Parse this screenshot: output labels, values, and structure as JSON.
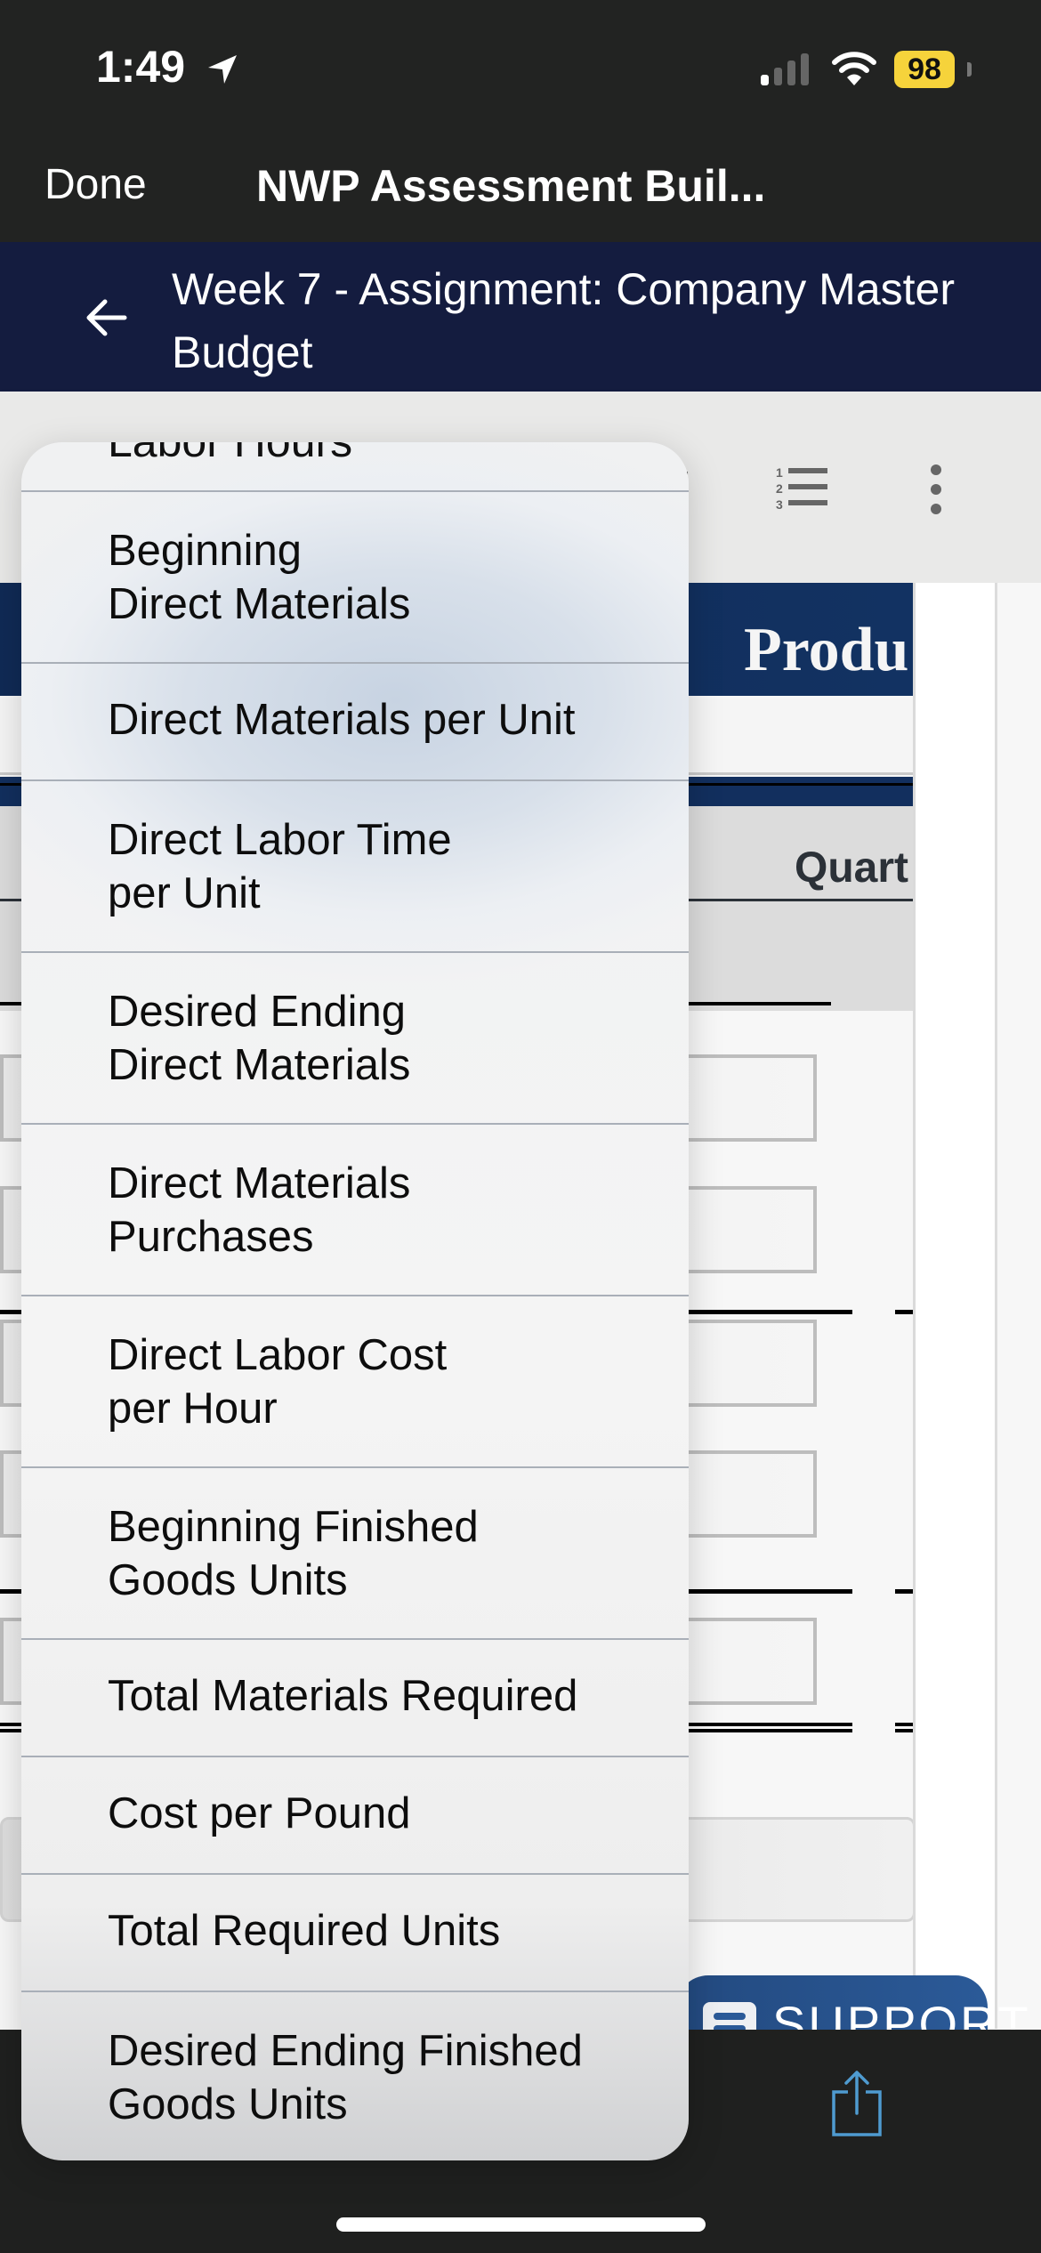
{
  "status_bar": {
    "time": "1:49",
    "battery": "98",
    "icons": [
      "location-arrow-icon",
      "cellular-signal-icon",
      "wifi-icon",
      "battery-icon"
    ]
  },
  "browser_nav": {
    "done_label": "Done",
    "title": "NWP Assessment Buil..."
  },
  "header": {
    "back_icon": "arrow-left-icon",
    "title": "Week 7 - Assignment: Company Master Budget"
  },
  "toolbar": {
    "icons": [
      "numbered-list-icon",
      "more-vertical-icon"
    ]
  },
  "document": {
    "title_partial": "Produ",
    "column_header_partial": "Quart"
  },
  "support_button": {
    "label": "SUPPORT",
    "icon": "chat-icon"
  },
  "bottom_bar": {
    "icons": [
      "share-icon"
    ]
  },
  "dropdown_menu": {
    "clipped_item": "Labor Hours",
    "items": [
      {
        "label_line1": "Beginning",
        "label_line2": "Direct Materials"
      },
      {
        "label_line1": "Direct Materials per Unit",
        "label_line2": ""
      },
      {
        "label_line1": "Direct Labor Time",
        "label_line2": "per Unit"
      },
      {
        "label_line1": "Desired Ending",
        "label_line2": "Direct Materials"
      },
      {
        "label_line1": "Direct Materials",
        "label_line2": "Purchases"
      },
      {
        "label_line1": "Direct Labor Cost",
        "label_line2": "per Hour"
      },
      {
        "label_line1": "Beginning Finished",
        "label_line2": "Goods Units"
      },
      {
        "label_line1": "Total Materials Required",
        "label_line2": ""
      },
      {
        "label_line1": "Cost per Pound",
        "label_line2": ""
      },
      {
        "label_line1": "Total Required Units",
        "label_line2": ""
      },
      {
        "label_line1": "Desired Ending Finished",
        "label_line2": "Goods Units"
      }
    ]
  }
}
